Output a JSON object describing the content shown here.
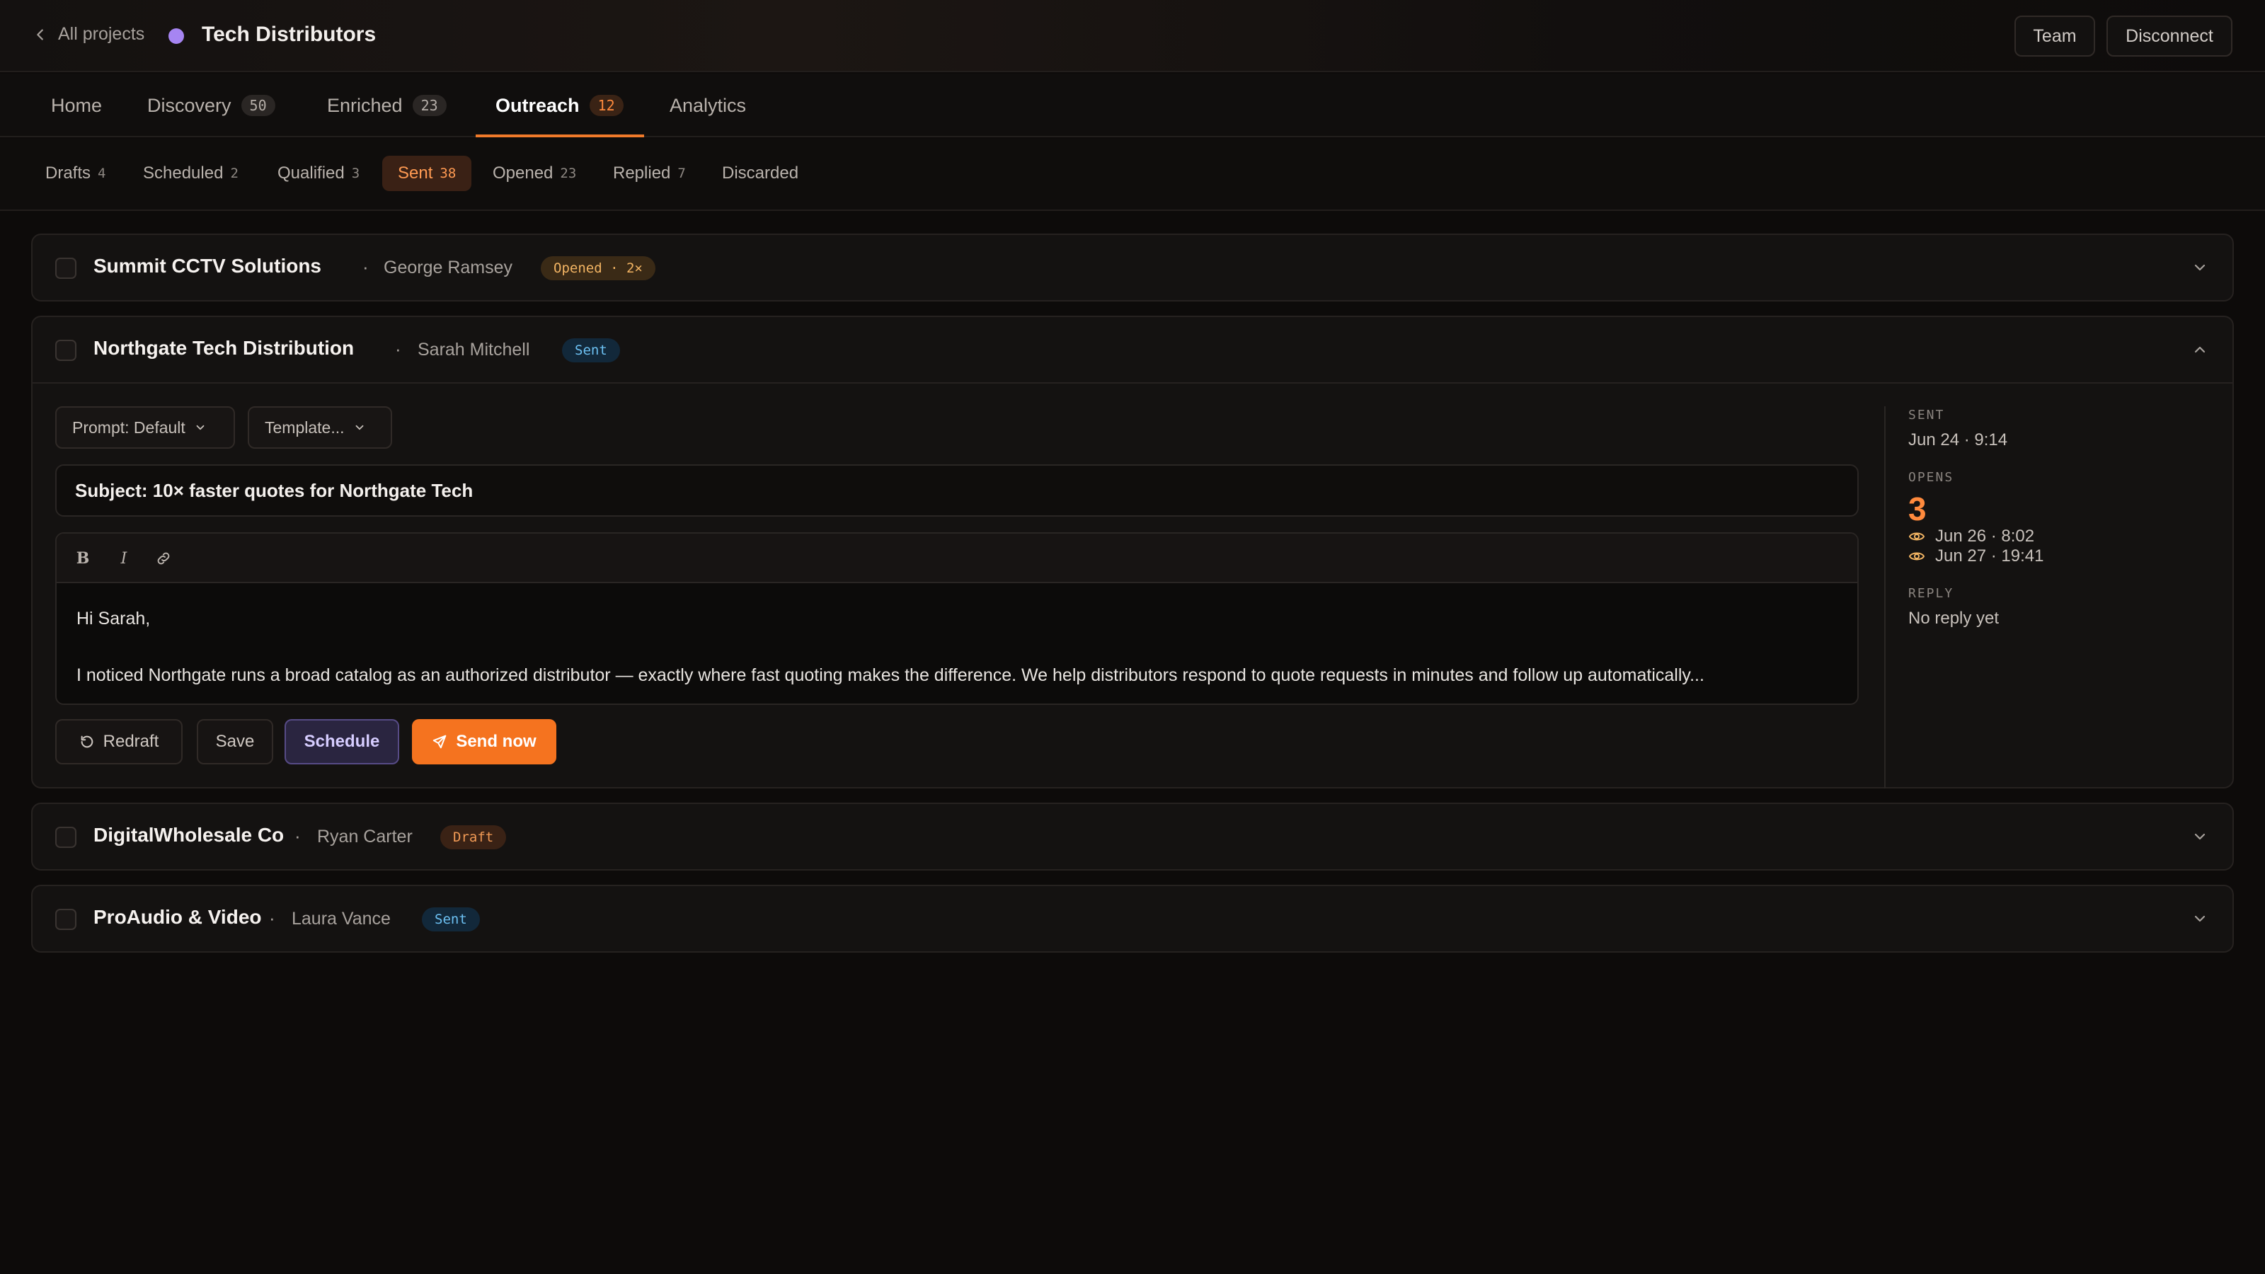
{
  "header": {
    "back_label": "All projects",
    "project_name": "Tech Distributors",
    "project_color": "#a685f2",
    "team_label": "Team",
    "disconnect_label": "Disconnect"
  },
  "main_tabs": [
    {
      "label": "Home",
      "count": null
    },
    {
      "label": "Discovery",
      "count": "50"
    },
    {
      "label": "Enriched",
      "count": "23"
    },
    {
      "label": "Outreach",
      "count": "12",
      "active": true
    },
    {
      "label": "Analytics",
      "count": null
    }
  ],
  "sub_tabs": [
    {
      "label": "Drafts",
      "count": "4"
    },
    {
      "label": "Scheduled",
      "count": "2"
    },
    {
      "label": "Qualified",
      "count": "3"
    },
    {
      "label": "Sent",
      "count": "38",
      "active": true
    },
    {
      "label": "Opened",
      "count": "23"
    },
    {
      "label": "Replied",
      "count": "7"
    },
    {
      "label": "Discarded",
      "count": ""
    }
  ],
  "cards": [
    {
      "company": "Summit CCTV Solutions",
      "contact": "George Ramsey",
      "badge": "Opened · 2×",
      "badge_type": "opened"
    },
    {
      "company": "Northgate Tech Distribution",
      "contact": "Sarah Mitchell",
      "badge": "Sent",
      "badge_type": "sent",
      "expanded": true
    },
    {
      "company": "DigitalWholesale Co",
      "contact": "Ryan Carter",
      "badge": "Draft",
      "badge_type": "draft"
    },
    {
      "company": "ProAudio & Video",
      "contact": "Laura Vance",
      "badge": "Sent",
      "badge_type": "sent"
    }
  ],
  "separator": "·",
  "editor": {
    "prompt_label": "Prompt: Default",
    "template_label": "Template...",
    "subject": "Subject: 10× faster quotes for Northgate Tech",
    "bold_label": "B",
    "italic_label": "I",
    "body_greeting": "Hi Sarah,",
    "body_paragraph": "I noticed Northgate runs a broad catalog as an authorized distributor — exactly where fast quoting makes the difference. We help distributors respond to quote requests in minutes and follow up automatically...",
    "redraft_label": "Redraft",
    "save_label": "Save",
    "schedule_label": "Schedule",
    "send_label": "Send now"
  },
  "meta": {
    "sent_label": "SENT",
    "sent_value": "Jun 24 · 9:14",
    "opens_label": "OPENS",
    "opens_count": "3",
    "opens": [
      "Jun 26 · 8:02",
      "Jun 27 · 19:41"
    ],
    "reply_label": "REPLY",
    "reply_value": "No reply yet"
  },
  "colors": {
    "accent": "#f5731f",
    "schedule": "#574b86",
    "sent_badge": "#6cc0f2",
    "opened_badge": "#f2b463"
  }
}
